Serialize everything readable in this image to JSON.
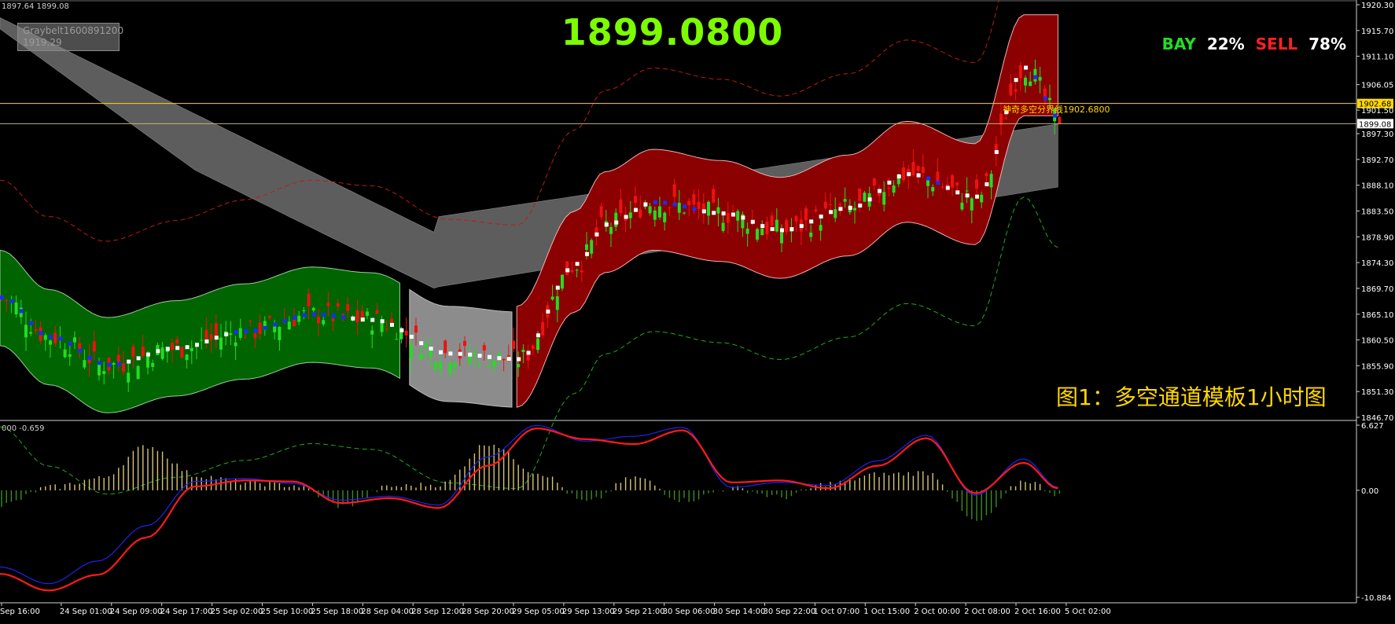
{
  "header": {
    "top_info": "1897.64 1899.08",
    "sub_info": "000 -0.659",
    "current_price": "1899.0800",
    "bay_label": "BAY",
    "bay_pct": "22%",
    "sell_label": "SELL",
    "sell_pct": "78%",
    "caption": "图1：多空通道模板1小时图",
    "gray_box_line1": "Graybelt1600891200",
    "gray_box_line2": "1919.29",
    "boundary_label": "神奇多空分界线1902.6800"
  },
  "colors": {
    "background": "#000000",
    "bull_candle": "#22dd22",
    "bear_candle": "#ee1111",
    "green_channel": "#006400",
    "red_channel": "#8b0000",
    "gray_belt": "#6e6e6e",
    "price_line": "#ffd700",
    "macd_line": "#ff1a1a",
    "signal_line": "#2222ee"
  },
  "chart_data": [
    {
      "type": "candlestick",
      "title": "",
      "y_ticks": [
        "1920.30",
        "1915.70",
        "1911.10",
        "1906.05",
        "1901.50",
        "1897.30",
        "1892.70",
        "1888.10",
        "1883.50",
        "1878.90",
        "1874.30",
        "1869.70",
        "1865.10",
        "1860.50",
        "1855.90",
        "1851.30",
        "1846.70"
      ],
      "ylim": [
        1846.7,
        1920.3
      ],
      "price_tags": [
        "1902.68",
        "1899.08"
      ],
      "boundary_price": 1902.68,
      "current_price": 1899.08,
      "x_ticks": [
        "Sep 16:00",
        "24 Sep 01:00",
        "24 Sep 09:00",
        "24 Sep 17:00",
        "25 Sep 02:00",
        "25 Sep 10:00",
        "25 Sep 18:00",
        "28 Sep 04:00",
        "28 Sep 12:00",
        "28 Sep 20:00",
        "29 Sep 05:00",
        "29 Sep 13:00",
        "29 Sep 21:00",
        "30 Sep 06:00",
        "30 Sep 14:00",
        "30 Sep 22:00",
        "1 Oct 07:00",
        "1 Oct 15:00",
        "2 Oct 00:00",
        "2 Oct 08:00",
        "2 Oct 16:00",
        "5 Oct 02:00"
      ],
      "close_path": {
        "x": [
          0,
          10,
          22,
          36,
          50,
          64,
          76,
          92,
          106,
          118,
          124,
          134,
          148,
          160,
          174,
          186,
          200,
          210,
          217
        ],
        "y": [
          1868,
          1861,
          1856,
          1859,
          1862,
          1865,
          1864,
          1858,
          1857,
          1874,
          1881,
          1885,
          1883,
          1880,
          1884,
          1890,
          1886,
          1909,
          1900
        ]
      },
      "green_channel": {
        "x_start": 0,
        "x_end": 82
      },
      "red_channel": {
        "x_start": 106,
        "x_end": 217
      },
      "gray_belt": "Graybelt"
    },
    {
      "type": "macd",
      "y_ticks": [
        "6.627",
        "0.00",
        "-10.884"
      ],
      "ylim": [
        -10.884,
        6.627
      ],
      "macd": {
        "x": [
          0,
          10,
          20,
          30,
          40,
          50,
          60,
          70,
          80,
          90,
          100,
          110,
          120,
          130,
          140,
          150,
          160,
          170,
          180,
          190,
          200,
          210,
          217
        ],
        "y": [
          -8.5,
          -10.2,
          -8.6,
          -4.8,
          0.4,
          1.0,
          0.9,
          -1.3,
          -0.8,
          -1.8,
          2.5,
          6.3,
          5.2,
          4.7,
          6.1,
          0.8,
          1.0,
          0.2,
          2.5,
          5.3,
          -0.3,
          2.8,
          0.2
        ]
      },
      "signal": {
        "x": [
          0,
          10,
          20,
          30,
          40,
          50,
          60,
          70,
          80,
          90,
          100,
          110,
          120,
          130,
          140,
          150,
          160,
          170,
          180,
          190,
          200,
          210,
          217
        ],
        "y": [
          -7.8,
          -9.5,
          -7.2,
          -3.6,
          0.9,
          1.2,
          0.7,
          -1.0,
          -0.6,
          -1.5,
          3.4,
          6.6,
          5.0,
          5.5,
          6.4,
          0.3,
          0.8,
          0.5,
          3.0,
          5.6,
          -0.5,
          3.2,
          0.3
        ]
      },
      "hist": {
        "x": [
          0,
          10,
          20,
          30,
          40,
          50,
          60,
          70,
          80,
          90,
          100,
          110,
          120,
          130,
          140,
          150,
          160,
          170,
          180,
          190,
          200,
          210,
          217
        ],
        "y": [
          -1.5,
          0.3,
          1.2,
          4.5,
          1.5,
          0.8,
          0.5,
          -1.6,
          0.4,
          0.6,
          4.8,
          1.8,
          -1.2,
          1.3,
          -1.0,
          0.2,
          -0.7,
          0.7,
          1.6,
          1.8,
          -3.2,
          1.0,
          -0.4
        ]
      }
    }
  ]
}
